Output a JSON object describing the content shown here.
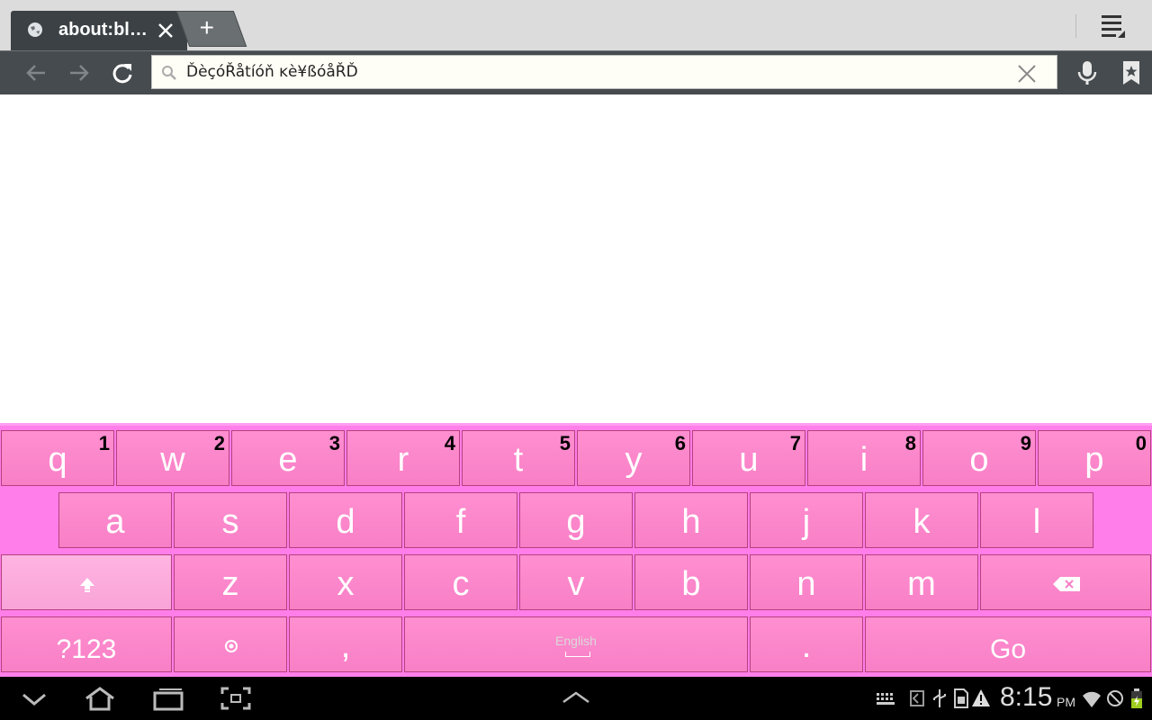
{
  "browser": {
    "tab_title": "about:bl…",
    "new_tab_label": "+",
    "omnibox_text": "ĎèçóŘåtíóň ĸè¥ßóåŘĎ"
  },
  "keyboard": {
    "row1": [
      {
        "key": "q",
        "hint": "1"
      },
      {
        "key": "w",
        "hint": "2"
      },
      {
        "key": "e",
        "hint": "3"
      },
      {
        "key": "r",
        "hint": "4"
      },
      {
        "key": "t",
        "hint": "5"
      },
      {
        "key": "y",
        "hint": "6"
      },
      {
        "key": "u",
        "hint": "7"
      },
      {
        "key": "i",
        "hint": "8"
      },
      {
        "key": "o",
        "hint": "9"
      },
      {
        "key": "p",
        "hint": "0"
      }
    ],
    "row2": [
      "a",
      "s",
      "d",
      "f",
      "g",
      "h",
      "j",
      "k",
      "l"
    ],
    "row3": [
      "z",
      "x",
      "c",
      "v",
      "b",
      "n",
      "m"
    ],
    "symbols_label": "?123",
    "comma": ",",
    "space_label": "English",
    "period": ".",
    "go_label": "Go"
  },
  "status": {
    "time": "8:15",
    "ampm": "PM"
  },
  "icons": [
    "globe-icon",
    "close-icon",
    "menu-icon",
    "back-icon",
    "forward-icon",
    "reload-icon",
    "search-icon",
    "clear-icon",
    "mic-icon",
    "bookmark-icon",
    "shift-icon",
    "backspace-icon",
    "settings-icon",
    "nav-down-icon",
    "home-icon",
    "recent-apps-icon",
    "screenshot-icon",
    "up-arrow-icon",
    "keyboard-icon",
    "usb-icon",
    "sd-card-icon",
    "warning-icon",
    "wifi-icon",
    "no-signal-icon",
    "battery-icon"
  ]
}
